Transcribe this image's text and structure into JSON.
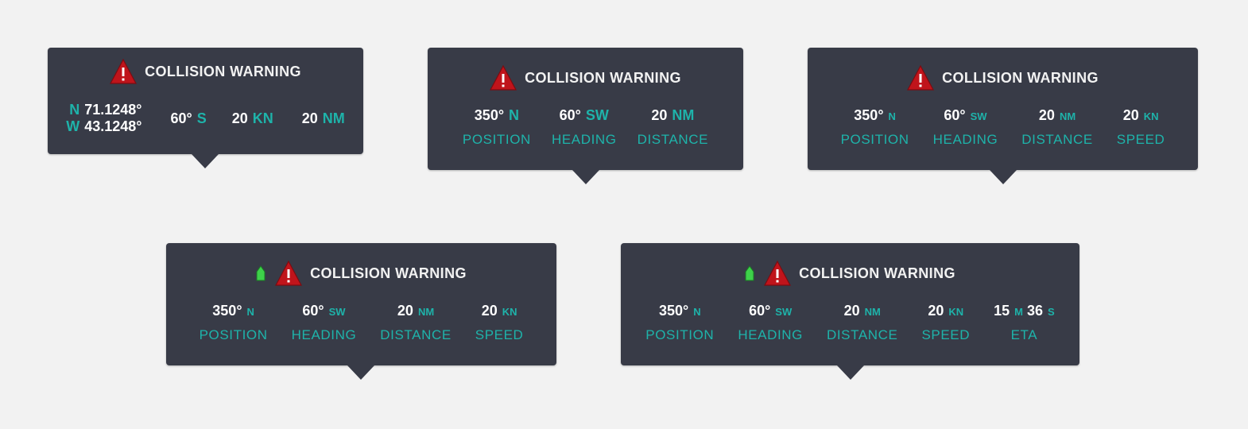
{
  "warning_title": "COLLISION WARNING",
  "colors": {
    "card_bg": "#383b47",
    "accent": "#1eb3aa",
    "alert_red": "#c0141b",
    "boat_green": "#3ed14a"
  },
  "cards": [
    {
      "coords": [
        {
          "dir": "N",
          "value": "71.1248°"
        },
        {
          "dir": "W",
          "value": "43.1248°"
        }
      ],
      "stats": [
        {
          "value": "60°",
          "unit": "S"
        },
        {
          "value": "20",
          "unit": "KN"
        },
        {
          "value": "20",
          "unit": "NM"
        }
      ]
    },
    {
      "stats": [
        {
          "value": "350°",
          "unit": "N",
          "label": "POSITION"
        },
        {
          "value": "60°",
          "unit": "SW",
          "label": "HEADING"
        },
        {
          "value": "20",
          "unit": "NM",
          "label": "DISTANCE"
        }
      ]
    },
    {
      "stats": [
        {
          "value": "350°",
          "unit": "N",
          "label": "POSITION"
        },
        {
          "value": "60°",
          "unit": "SW",
          "label": "HEADING"
        },
        {
          "value": "20",
          "unit": "NM",
          "label": "DISTANCE"
        },
        {
          "value": "20",
          "unit": "KN",
          "label": "SPEED"
        }
      ]
    },
    {
      "stats": [
        {
          "value": "350°",
          "unit": "N",
          "label": "POSITION"
        },
        {
          "value": "60°",
          "unit": "SW",
          "label": "HEADING"
        },
        {
          "value": "20",
          "unit": "NM",
          "label": "DISTANCE"
        },
        {
          "value": "20",
          "unit": "KN",
          "label": "SPEED"
        }
      ]
    },
    {
      "stats": [
        {
          "value": "350°",
          "unit": "N",
          "label": "POSITION"
        },
        {
          "value": "60°",
          "unit": "SW",
          "label": "HEADING"
        },
        {
          "value": "20",
          "unit": "NM",
          "label": "DISTANCE"
        },
        {
          "value": "20",
          "unit": "KN",
          "label": "SPEED"
        }
      ],
      "eta": {
        "minutes": "15",
        "minutes_unit": "M",
        "seconds": "36",
        "seconds_unit": "S",
        "label": "ETA"
      }
    }
  ]
}
